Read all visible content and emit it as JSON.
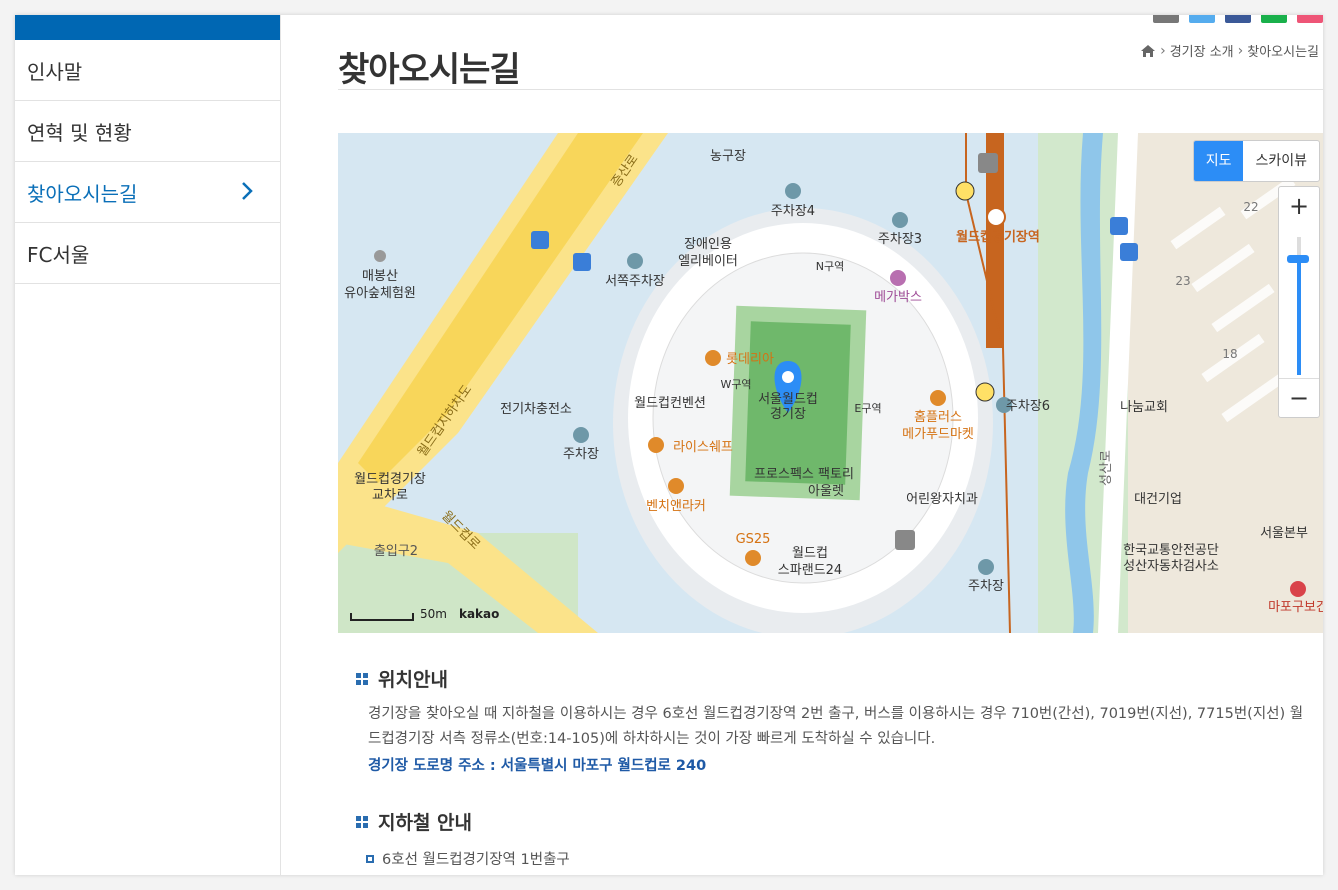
{
  "sidebar": {
    "items": [
      {
        "label": "인사말"
      },
      {
        "label": "연혁 및 현황"
      },
      {
        "label": "찾아오시는길",
        "active": true
      },
      {
        "label": "FC서울"
      }
    ]
  },
  "page": {
    "title": "찾아오시는길",
    "breadcrumb": [
      "home-icon",
      "경기장 소개",
      "찾아오시는길"
    ]
  },
  "map": {
    "view_buttons": [
      "지도",
      "스카이뷰"
    ],
    "selected_view": "지도",
    "zoom_in": "+",
    "zoom_out": "−",
    "scale_label": "50m",
    "provider": "kakao",
    "labels": {
      "stadium": [
        "서울월드컵",
        "경기장"
      ],
      "subway": "월드컵경기장역",
      "parking4": "주차장4",
      "parking3": "주차장3",
      "parking6": "주차장6",
      "parking_w": "서쪽주차장",
      "parking": "주차장",
      "n_zone": "N구역",
      "w_zone": "W구역",
      "e_zone": "E구역",
      "megabox": "메가박스",
      "lotteria": "롯데리아",
      "elevator": [
        "장애인용",
        "엘리베이터"
      ],
      "convention": "월드컵컨벤션",
      "riceshef": "라이스쉐프",
      "bench": "벤치앤라커",
      "gs25": "GS25",
      "sparland": [
        "월드컵",
        "스파랜드24"
      ],
      "prospecs": [
        "프로스펙스 팩토리",
        "아울렛"
      ],
      "homeplus": [
        "홈플러스",
        "메가푸드마켓"
      ],
      "kids": "어린왕자치과",
      "ev": "전기차충전소",
      "forest": [
        "매봉산",
        "유아숲체험원"
      ],
      "interchange": [
        "월드컵경기장",
        "교차로"
      ],
      "basketball": "농구장",
      "nanum": "나눔교회",
      "daegun": "대건기업",
      "traffic": [
        "한국교통안전공단",
        "성산자동차검사소"
      ],
      "seoul_hq": "서울본부",
      "mapo": "마포구보건",
      "jeungsan": "증산로",
      "gangbyeon": "월드컵로",
      "exit2": "출입구2",
      "underpass": "월드컵지하차도",
      "seongsan": "성산로",
      "num22": "22",
      "num23": "23",
      "num18": "18"
    }
  },
  "location": {
    "heading": "위치안내",
    "text": "경기장을 찾아오실 때 지하철을 이용하시는 경우 6호선 월드컵경기장역 2번 출구, 버스를 이용하시는 경우 710번(간선), 7019번(지선), 7715번(지선) 월드컵경기장 서측 정류소(번호:14-105)에 하차하시는 것이 가장 빠르게 도착하실 수 있습니다.",
    "address": "경기장 도로명 주소 : 서울특별시 마포구 월드컵로 240"
  },
  "subway": {
    "heading": "지하철 안내",
    "items": [
      "6호선 월드컵경기장역 1번출구"
    ]
  },
  "colors": {
    "brand": "#0067b3",
    "active_text": "#0a6fb8",
    "map_button": "#2c8df6",
    "subway_line6": "#c7651f"
  }
}
